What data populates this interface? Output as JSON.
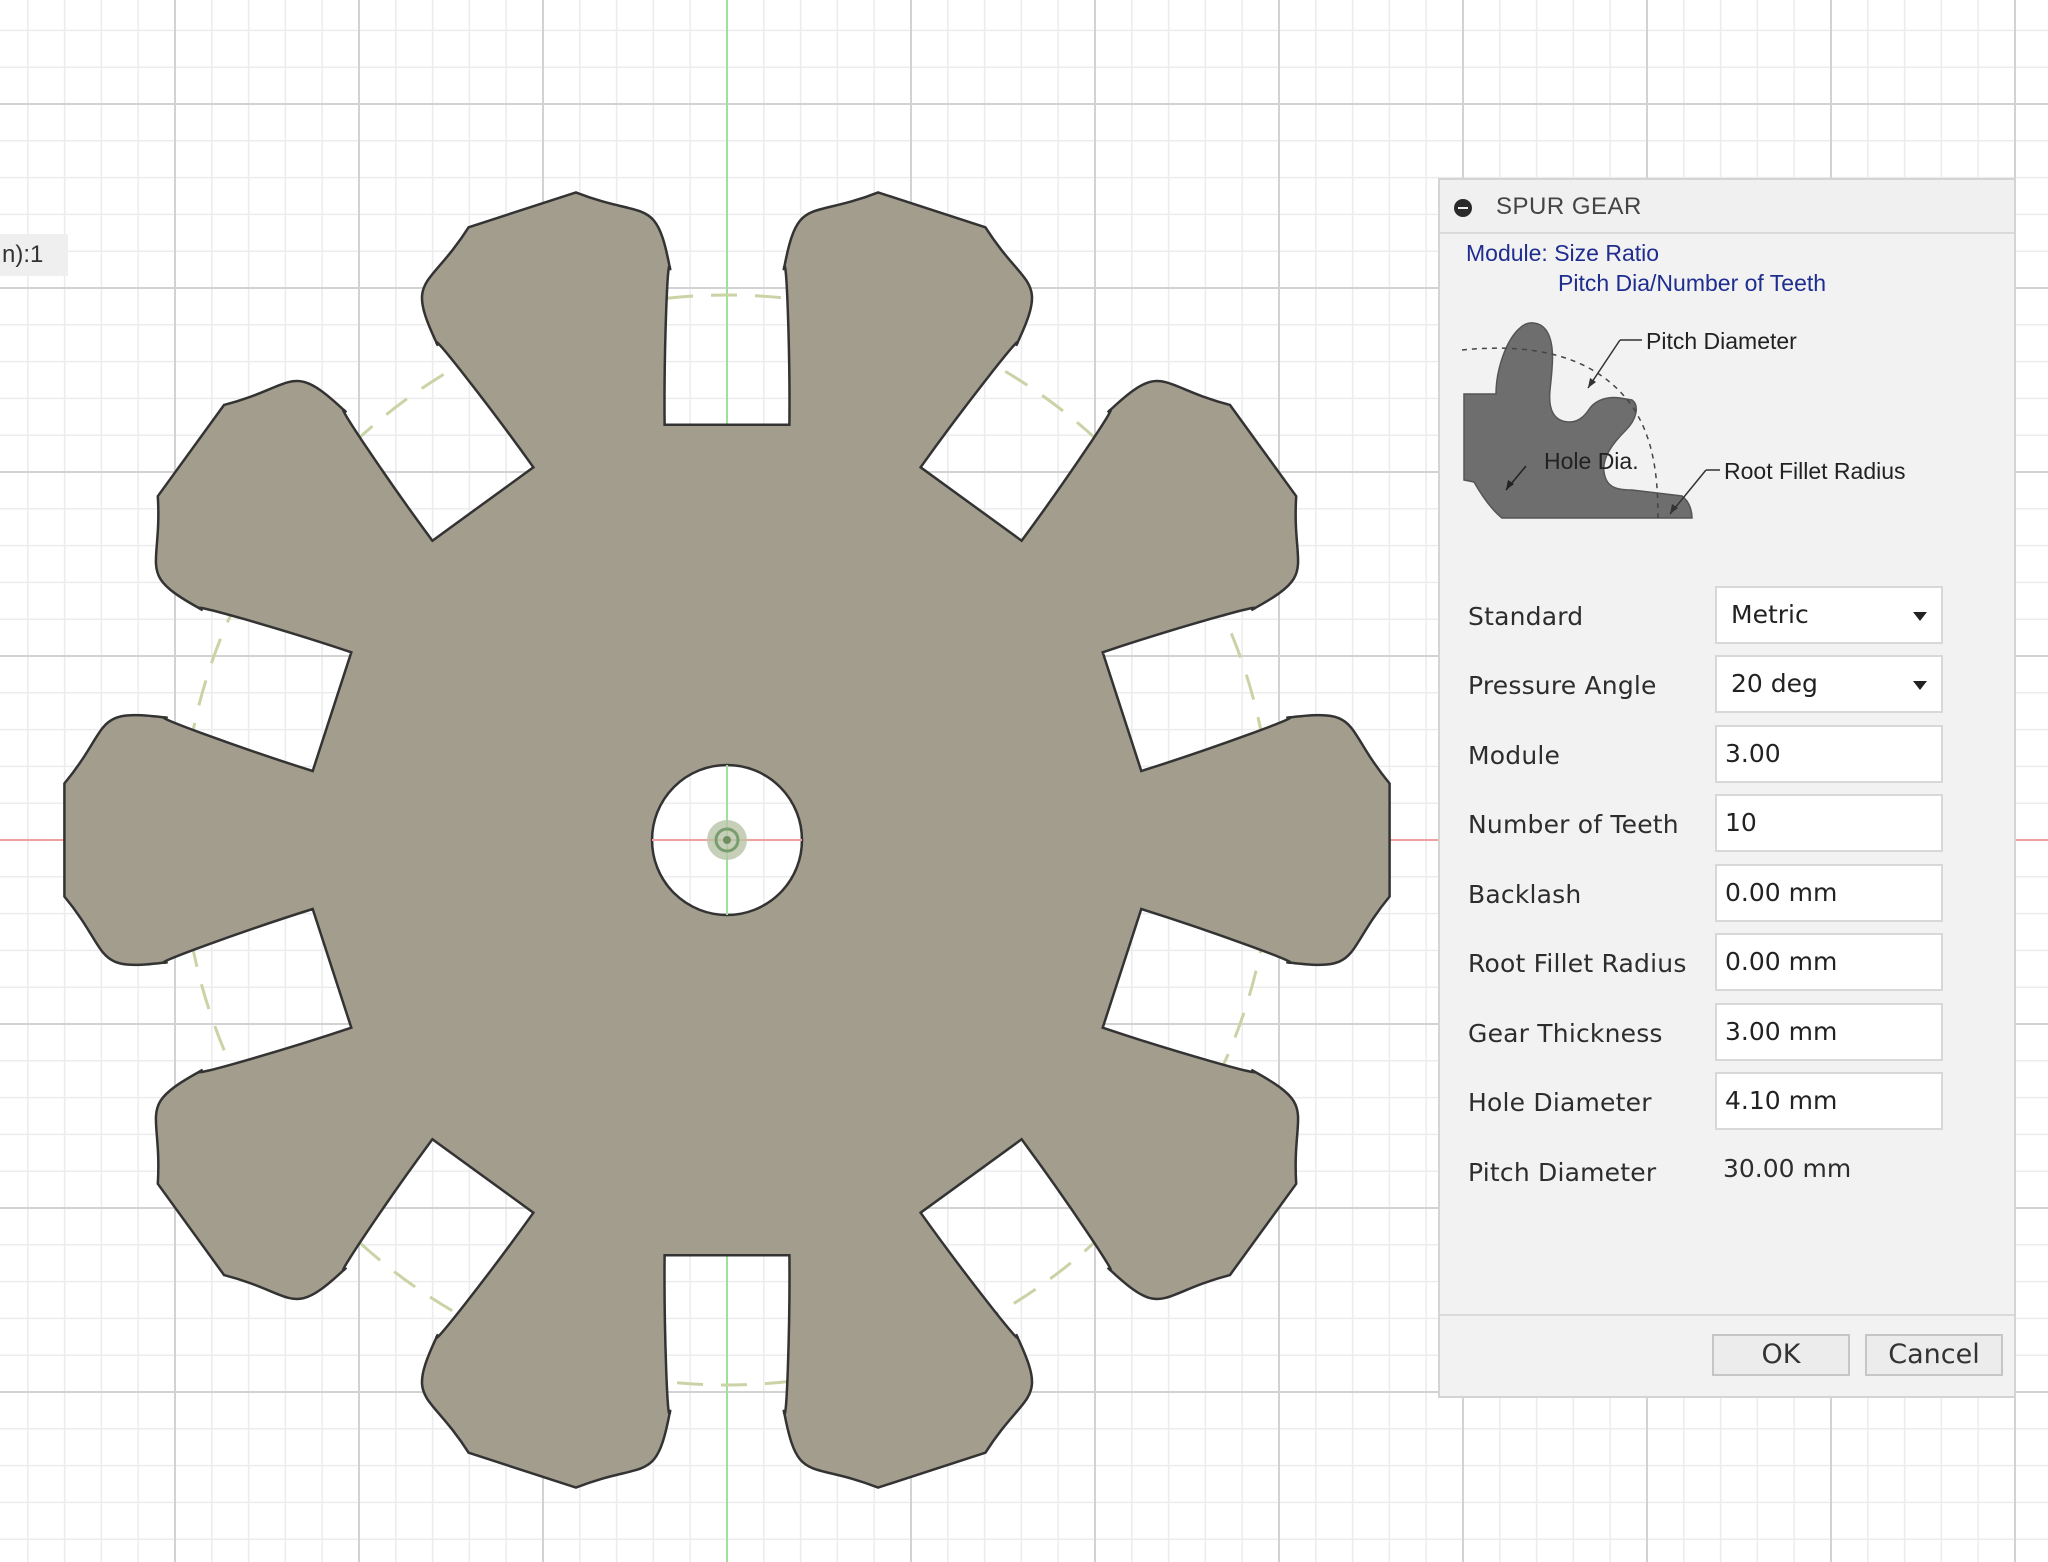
{
  "viewport": {
    "scale_label": "n):1"
  },
  "dialog": {
    "title": "SPUR GEAR",
    "help": {
      "line1": "Module: Size Ratio",
      "line2": "Pitch Dia/Number of Teeth"
    },
    "diagram_labels": {
      "pitch_diameter": "Pitch Diameter",
      "hole_dia": "Hole Dia.",
      "root_fillet_radius": "Root Fillet Radius"
    },
    "fields": {
      "standard": {
        "label": "Standard",
        "value": "Metric"
      },
      "pressure_angle": {
        "label": "Pressure Angle",
        "value": "20 deg"
      },
      "module": {
        "label": "Module",
        "value": "3.00"
      },
      "number_of_teeth": {
        "label": "Number of Teeth",
        "value": "10"
      },
      "backlash": {
        "label": "Backlash",
        "value": "0.00 mm"
      },
      "root_fillet_radius": {
        "label": "Root Fillet Radius",
        "value": "0.00 mm"
      },
      "gear_thickness": {
        "label": "Gear Thickness",
        "value": "3.00 mm"
      },
      "hole_diameter": {
        "label": "Hole Diameter",
        "value": "4.10 mm"
      },
      "pitch_diameter": {
        "label": "Pitch Diameter",
        "value": "30.00 mm"
      }
    },
    "buttons": {
      "ok": "OK",
      "cancel": "Cancel"
    }
  },
  "colors": {
    "gear_fill": "#a39d8d",
    "grid_major": "#d2d2d2",
    "grid_minor": "#ececec",
    "axis_green": "#9fe09a",
    "axis_red": "#f0a0a0",
    "help_text": "#1f2d8f"
  }
}
